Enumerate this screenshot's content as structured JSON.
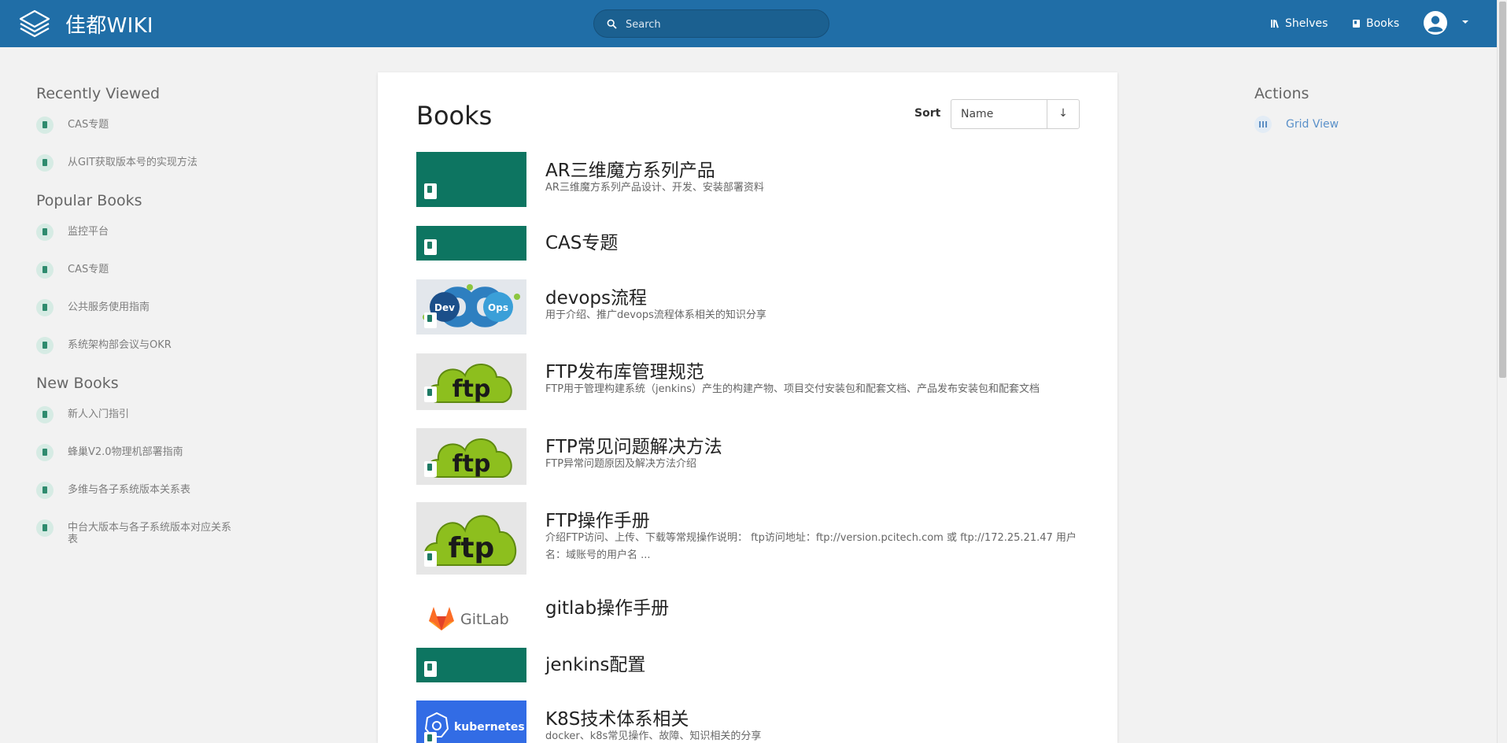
{
  "header": {
    "brand": "佳都WIKI",
    "search_placeholder": "Search",
    "nav": {
      "shelves": "Shelves",
      "books": "Books"
    }
  },
  "sidebar": {
    "recently_viewed": {
      "title": "Recently Viewed",
      "items": [
        "CAS专题",
        "从GIT获取版本号的实现方法"
      ]
    },
    "popular_books": {
      "title": "Popular Books",
      "items": [
        "监控平台",
        "CAS专题",
        "公共服务使用指南",
        "系统架构部会议与OKR"
      ]
    },
    "new_books": {
      "title": "New Books",
      "items": [
        "新人入门指引",
        "蜂巢V2.0物理机部署指南",
        "多维与各子系统版本关系表",
        "中台大版本与各子系统版本对应关系表"
      ]
    }
  },
  "main": {
    "title": "Books",
    "sort": {
      "label": "Sort",
      "value": "Name",
      "direction": "↓"
    },
    "books": [
      {
        "title": "AR三维魔方系列产品",
        "desc": "AR三维魔方系列产品设计、开发、安装部署资料",
        "cover": "default"
      },
      {
        "title": "CAS专题",
        "desc": "",
        "cover": "default"
      },
      {
        "title": "devops流程",
        "desc": "用于介绍、推广devops流程体系相关的知识分享",
        "cover": "devops"
      },
      {
        "title": "FTP发布库管理规范",
        "desc": "FTP用于管理构建系统（jenkins）产生的构建产物、项目交付安装包和配套文档、产品发布安装包和配套文档",
        "cover": "ftp"
      },
      {
        "title": "FTP常见问题解决方法",
        "desc": "FTP异常问题原因及解决方法介绍",
        "cover": "ftp"
      },
      {
        "title": "FTP操作手册",
        "desc": "介绍FTP访问、上传、下载等常规操作说明： ftp访问地址：ftp://version.pcitech.com 或 ftp://172.25.21.47   用户名：域账号的用户名 ...",
        "cover": "ftp"
      },
      {
        "title": "gitlab操作手册",
        "desc": "",
        "cover": "gitlab"
      },
      {
        "title": "jenkins配置",
        "desc": "",
        "cover": "default"
      },
      {
        "title": "K8S技术体系相关",
        "desc": "docker、k8s常见操作、故障、知识相关的分享",
        "cover": "kubernetes"
      }
    ],
    "cover_text": {
      "dev": "Dev",
      "ops": "Ops",
      "ftp": "ftp",
      "gitlab": "GitLab",
      "kubernetes": "kubernetes"
    }
  },
  "actions": {
    "title": "Actions",
    "grid_view": "Grid View"
  },
  "colors": {
    "header": "#206ea7",
    "book_cover": "#0d7561",
    "link": "#5a90c9"
  }
}
